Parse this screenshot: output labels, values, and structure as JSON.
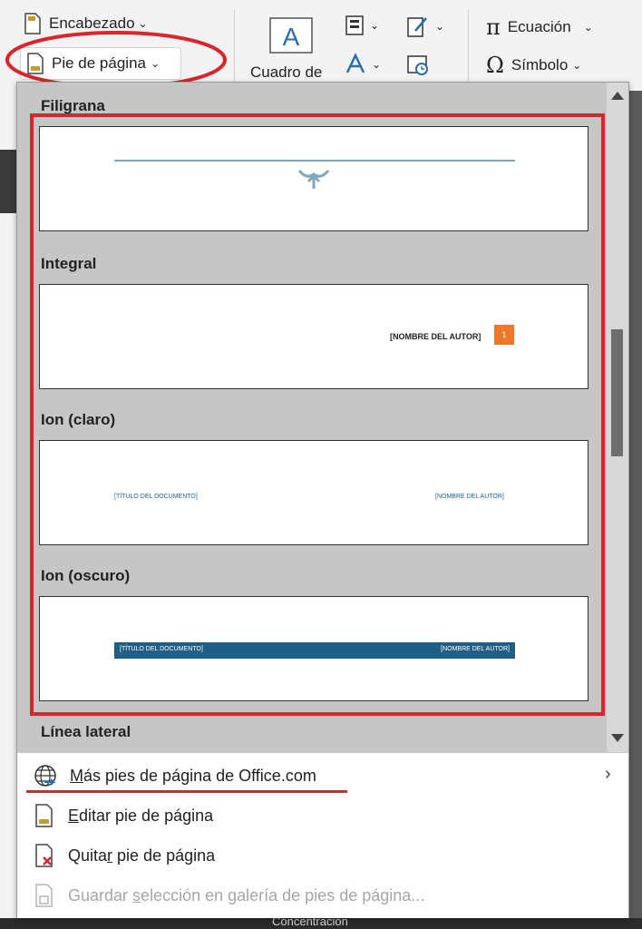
{
  "ribbon": {
    "header_label": "Encabezado",
    "footer_label": "Pie de página",
    "textbox_label": "Cuadro de",
    "equation_label": "Ecuación",
    "symbol_label": "Símbolo"
  },
  "gallery": {
    "sections": [
      {
        "title": "Filigrana"
      },
      {
        "title": "Integral",
        "author": "[NOMBRE DEL AUTOR]",
        "page": "1"
      },
      {
        "title": "Ion (claro)",
        "doc": "[TÍTULO DEL DOCUMENTO]",
        "author": "[NOMBRE DEL AUTOR]"
      },
      {
        "title": "Ion (oscuro)",
        "doc": "[TÍTULO DEL DOCUMENTO]",
        "author": "[NOMBRE DEL AUTOR]"
      },
      {
        "title": "Línea lateral"
      }
    ]
  },
  "menu": {
    "more": {
      "underline": "M",
      "rest": "ás pies de página de Office.com"
    },
    "edit": {
      "underline": "E",
      "rest": "ditar pie de página"
    },
    "remove": {
      "pre": "Quita",
      "underline": "r",
      "rest": " pie de página"
    },
    "save": {
      "pre": "Guardar ",
      "underline": "s",
      "rest": "elección en galería de pies de página..."
    }
  },
  "status": {
    "focus": "Concentración"
  },
  "colors": {
    "annotation": "#d9252b",
    "ion_blue": "#1f5f86",
    "integral_orange": "#ea7a2a",
    "filigrana_line": "#7fa6ba"
  }
}
